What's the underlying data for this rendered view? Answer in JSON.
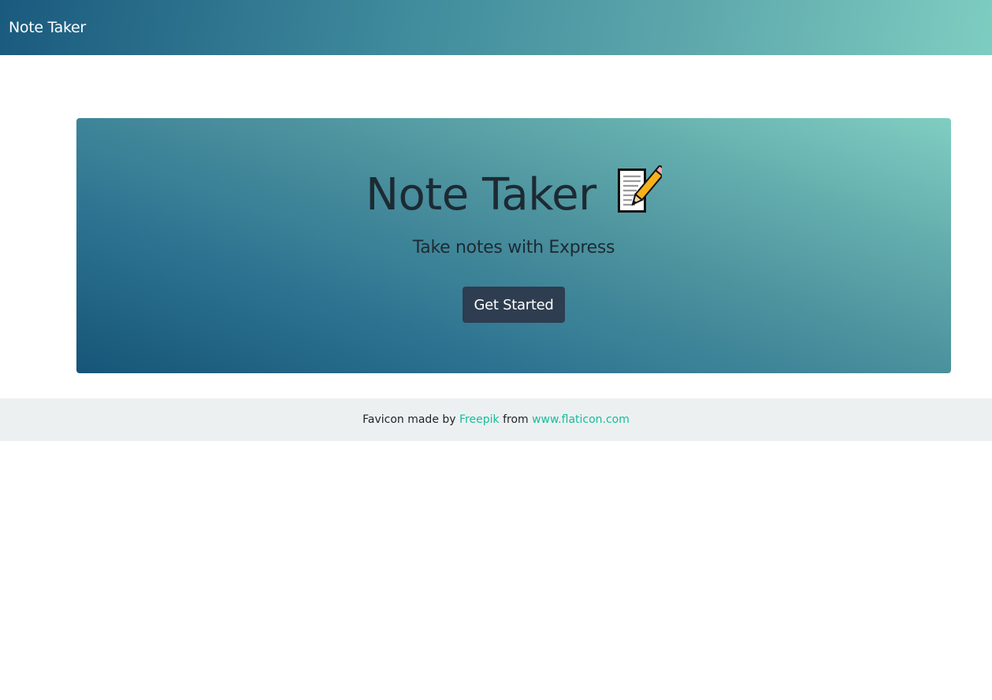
{
  "navbar": {
    "brand": "Note Taker"
  },
  "hero": {
    "title": "Note Taker",
    "icon": "memo-icon",
    "subtitle": "Take notes with Express",
    "button_label": "Get Started"
  },
  "footer": {
    "prefix": "Favicon made by",
    "author_link": "Freepik",
    "middle": "from",
    "site_link": "www.flaticon.com"
  },
  "colors": {
    "navbar_gradient_start": "#1a5a7e",
    "navbar_gradient_end": "#7ecdc1",
    "button_bg": "#2e3d50",
    "footer_bg": "#ecf0f1",
    "link": "#18bc9c"
  }
}
